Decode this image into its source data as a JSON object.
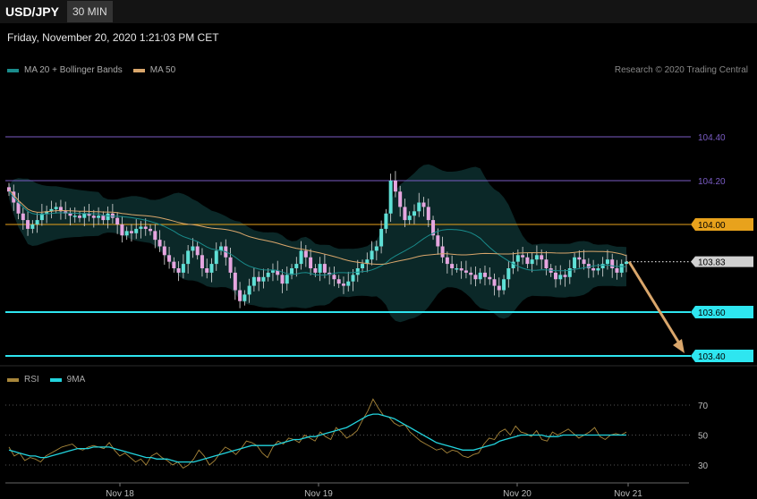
{
  "header": {
    "symbol": "USD/JPY",
    "timeframe": "30 MIN",
    "date": "Friday, November 20, 2020 1:21:03 PM CET",
    "credit": "Research © 2020 Trading Central"
  },
  "legend": {
    "ma20": {
      "label": "MA 20 + Bollinger Bands",
      "color": "#1a8c8c"
    },
    "ma50": {
      "label": "MA 50",
      "color": "#d9a66b"
    }
  },
  "rsi_legend": {
    "rsi": {
      "label": "RSI",
      "color": "#a8863a"
    },
    "ma9": {
      "label": "9MA",
      "color": "#22d3dd"
    }
  },
  "chart_data": [
    {
      "type": "candlestick",
      "title": "",
      "ylim": [
        103.4,
        104.4
      ],
      "x_ticks": [
        "Nov 18",
        "Nov 19",
        "Nov 20",
        "Nov 21"
      ],
      "current_price": "103.83",
      "levels": [
        {
          "value": 104.4,
          "label": "104.40",
          "color": "#7a5cc4",
          "style": "line"
        },
        {
          "value": 104.2,
          "label": "104.20",
          "color": "#7a5cc4",
          "style": "line"
        },
        {
          "value": 104.0,
          "label": "104.00",
          "color": "#e8a21c",
          "style": "tag"
        },
        {
          "value": 103.83,
          "label": "103.83",
          "color": "#d0d0d0",
          "style": "price"
        },
        {
          "value": 103.6,
          "label": "103.60",
          "color": "#2ee6f0",
          "style": "tag"
        },
        {
          "value": 103.4,
          "label": "103.40",
          "color": "#2ee6f0",
          "style": "tag"
        }
      ],
      "closes": [
        104.15,
        104.1,
        104.05,
        104.02,
        103.98,
        104.0,
        104.02,
        104.05,
        104.06,
        104.07,
        104.08,
        104.06,
        104.05,
        104.04,
        104.04,
        104.03,
        104.05,
        104.04,
        104.03,
        104.04,
        104.02,
        104.05,
        104.03,
        104.0,
        103.95,
        103.97,
        103.96,
        103.98,
        103.99,
        103.98,
        103.97,
        103.93,
        103.9,
        103.86,
        103.83,
        103.8,
        103.78,
        103.82,
        103.88,
        103.9,
        103.86,
        103.8,
        103.78,
        103.82,
        103.88,
        103.9,
        103.85,
        103.78,
        103.7,
        103.65,
        103.68,
        103.72,
        103.76,
        103.74,
        103.76,
        103.78,
        103.79,
        103.77,
        103.73,
        103.77,
        103.8,
        103.82,
        103.88,
        103.85,
        103.8,
        103.78,
        103.82,
        103.78,
        103.77,
        103.75,
        103.73,
        103.72,
        103.74,
        103.77,
        103.8,
        103.82,
        103.84,
        103.88,
        103.9,
        103.98,
        104.05,
        104.2,
        104.15,
        104.08,
        104.02,
        104.04,
        104.06,
        104.1,
        104.08,
        104.02,
        103.95,
        103.9,
        103.85,
        103.82,
        103.8,
        103.8,
        103.79,
        103.78,
        103.77,
        103.75,
        103.78,
        103.76,
        103.75,
        103.72,
        103.7,
        103.75,
        103.8,
        103.83,
        103.86,
        103.85,
        103.82,
        103.84,
        103.86,
        103.84,
        103.8,
        103.78,
        103.75,
        103.77,
        103.76,
        103.8,
        103.85,
        103.84,
        103.82,
        103.8,
        103.79,
        103.8,
        103.82,
        103.84,
        103.8,
        103.78,
        103.82,
        103.83
      ],
      "ma20_band": "Bollinger Bands",
      "ma50_label": "MA 50"
    },
    {
      "type": "line",
      "title": "RSI",
      "ylim": [
        25,
        75
      ],
      "y_ticks": [
        "70",
        "50",
        "30"
      ],
      "series": [
        {
          "name": "RSI",
          "values": [
            42,
            36,
            38,
            33,
            35,
            34,
            32,
            36,
            38,
            40,
            42,
            43,
            44,
            41,
            40,
            42,
            43,
            42,
            41,
            45,
            40,
            36,
            38,
            35,
            32,
            34,
            30,
            36,
            38,
            35,
            33,
            30,
            32,
            28,
            30,
            34,
            40,
            36,
            30,
            33,
            38,
            42,
            40,
            37,
            41,
            46,
            45,
            43,
            38,
            35,
            42,
            46,
            44,
            48,
            47,
            45,
            50,
            48,
            46,
            52,
            49,
            47,
            55,
            52,
            48,
            50,
            53,
            60,
            66,
            74,
            68,
            63,
            62,
            58,
            56,
            57,
            52,
            49,
            46,
            44,
            42,
            40,
            41,
            38,
            40,
            39,
            36,
            35,
            37,
            38,
            44,
            48,
            47,
            52,
            54,
            50,
            56,
            52,
            51,
            49,
            53,
            47,
            46,
            52,
            50,
            52,
            54,
            51,
            48,
            50,
            52,
            55,
            49,
            47,
            50,
            51,
            50,
            52
          ]
        },
        {
          "name": "9MA",
          "values": [
            40,
            39,
            38,
            37,
            36,
            36,
            35,
            35,
            36,
            37,
            38,
            39,
            40,
            41,
            41,
            41,
            42,
            42,
            42,
            42,
            41,
            40,
            39,
            38,
            37,
            36,
            35,
            35,
            34,
            34,
            34,
            33,
            32,
            32,
            32,
            32,
            33,
            34,
            35,
            36,
            37,
            38,
            39,
            40,
            41,
            42,
            43,
            43,
            43,
            43,
            43,
            44,
            45,
            46,
            47,
            47,
            48,
            49,
            49,
            50,
            51,
            52,
            53,
            54,
            55,
            57,
            59,
            61,
            63,
            64,
            64,
            63,
            62,
            61,
            59,
            57,
            55,
            53,
            51,
            49,
            47,
            45,
            44,
            43,
            42,
            41,
            40,
            40,
            40,
            41,
            42,
            43,
            44,
            46,
            47,
            48,
            49,
            50,
            50,
            50,
            50,
            50,
            49,
            49,
            49,
            50,
            50,
            50,
            50,
            50,
            50,
            50,
            50,
            50,
            50,
            50,
            50,
            50
          ]
        }
      ]
    }
  ]
}
